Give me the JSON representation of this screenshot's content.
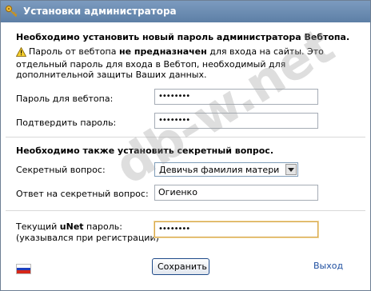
{
  "window": {
    "title": "Установки администратора",
    "title_icon": "key-icon"
  },
  "section1": {
    "heading": "Необходимо установить новый пароль администратора Вебтопа.",
    "warning_prefix": "Пароль от вебтопа ",
    "warning_bold": "не предназначен",
    "warning_suffix": " для входа на сайты. Это отдельный пароль для входа в Вебтоп, необходимый для дополнительной защиты Ваших данных.",
    "password_label": "Пароль для вебтопа:",
    "password_value": "••••••••",
    "confirm_label": "Подтвердить пароль:",
    "confirm_value": "••••••••"
  },
  "section2": {
    "heading": "Необходимо также установить секретный вопрос.",
    "question_label": "Секретный вопрос:",
    "question_selected": "Девичья фамилия матери",
    "answer_label": "Ответ на секретный вопрос:",
    "answer_value": "Огиенко"
  },
  "section3": {
    "current_label_prefix": "Текущий ",
    "current_label_brand": "uNet",
    "current_label_suffix": " пароль:",
    "current_label_note": "(указывался при регистрации)",
    "current_value": "••••••••"
  },
  "footer": {
    "save_label": "Сохранить",
    "exit_label": "Выход",
    "flag_colors": [
      "#ffffff",
      "#1c3fbf",
      "#d62718"
    ]
  },
  "watermark": "db-w.net",
  "colors": {
    "title_bar": "#6b8cb3",
    "link": "#1f4fa0"
  }
}
